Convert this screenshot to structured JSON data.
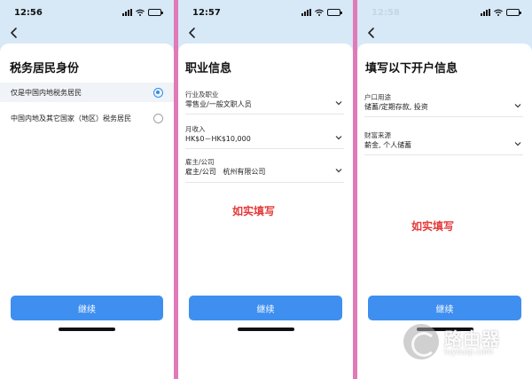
{
  "colors": {
    "accent": "#3e8ff0",
    "note_red": "#e43a3a",
    "header_bg": "#d7e8f7",
    "divider_pink": "#e07ab8"
  },
  "screens": [
    {
      "time": "12:56",
      "title": "税务居民身份",
      "options": [
        {
          "label": "仅是中国内地税务居民",
          "selected": true
        },
        {
          "label": "中国内地及其它国家（地区）税务居民",
          "selected": false
        }
      ],
      "continue_label": "继续"
    },
    {
      "time": "12:57",
      "title": "职业信息",
      "fields": [
        {
          "label": "行业及职业",
          "value": "零售业/一般文职人员"
        },
        {
          "label": "月收入",
          "value": "HK$0－HK$10,000"
        },
        {
          "label": "雇主/公司",
          "value": "雇主/公司   杭州有限公司"
        }
      ],
      "note": "如实填写",
      "continue_label": "继续"
    },
    {
      "time": "12:58",
      "title": "填写以下开户信息",
      "fields": [
        {
          "label": "户口用途",
          "value": "储蓄/定期存款, 投资"
        },
        {
          "label": "财富来源",
          "value": "薪金, 个人储蓄"
        }
      ],
      "note": "如实填写",
      "continue_label": "继续"
    }
  ],
  "watermark": {
    "name": "路由器",
    "domain": "luyouqi.com"
  }
}
